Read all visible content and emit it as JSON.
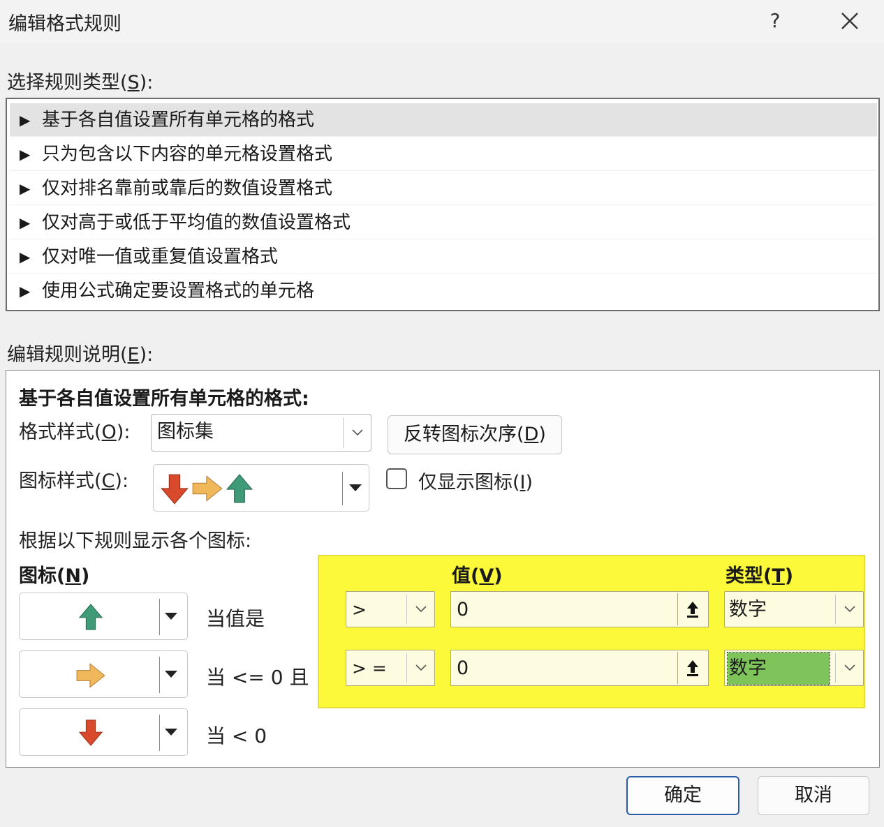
{
  "dialog": {
    "title": "编辑格式规则",
    "help": "?"
  },
  "rule_type": {
    "label_prefix": "选择规则类型(",
    "label_key": "S",
    "label_suffix": "):",
    "items": [
      {
        "label": "基于各自值设置所有单元格的格式",
        "selected": true
      },
      {
        "label": "只为包含以下内容的单元格设置格式",
        "selected": false
      },
      {
        "label": "仅对排名靠前或靠后的数值设置格式",
        "selected": false
      },
      {
        "label": "仅对高于或低于平均值的数值设置格式",
        "selected": false
      },
      {
        "label": "仅对唯一值或重复值设置格式",
        "selected": false
      },
      {
        "label": "使用公式确定要设置格式的单元格",
        "selected": false
      }
    ],
    "item_marker": "▶"
  },
  "rule_desc": {
    "label_prefix": "编辑规则说明(",
    "label_key": "E",
    "label_suffix": "):",
    "title": "基于各自值设置所有单元格的格式:",
    "format_style_label_prefix": "格式样式(",
    "format_style_label_key": "O",
    "format_style_label_suffix": "):",
    "format_style_value": "图标集",
    "reverse_button_prefix": "反转图标次序(",
    "reverse_button_key": "D",
    "reverse_button_suffix": ")",
    "icon_style_label_prefix": "图标样式(",
    "icon_style_label_key": "C",
    "icon_style_label_suffix": "):",
    "show_icon_only_prefix": "仅显示图标(",
    "show_icon_only_key": "I",
    "show_icon_only_suffix": ")",
    "show_icon_only_checked": false,
    "rules_intro": "根据以下规则显示各个图标:",
    "icon_header_prefix": "图标(",
    "icon_header_key": "N",
    "icon_header_suffix": ")",
    "value_header_prefix": "值(",
    "value_header_key": "V",
    "value_header_suffix": ")",
    "type_header_prefix": "类型(",
    "type_header_key": "T",
    "type_header_suffix": ")",
    "rows": [
      {
        "icon": "green-up-arrow-icon",
        "condition": "当值是",
        "operator": ">",
        "value": "0",
        "type": "数字"
      },
      {
        "icon": "yellow-right-arrow-icon",
        "condition": "当 <= 0 且",
        "operator": "> =",
        "value": "0",
        "type": "数字"
      },
      {
        "icon": "red-down-arrow-icon",
        "condition": "当 < 0"
      }
    ]
  },
  "footer": {
    "ok_label": "确定",
    "cancel_label": "取消"
  },
  "colors": {
    "green_arrow": "#3f9a77",
    "yellow_arrow": "#f0b85a",
    "red_arrow": "#d9492b",
    "highlight": "#fbf93a",
    "selected_type": "#7fc45a",
    "primary_border": "#2a5aa8"
  }
}
